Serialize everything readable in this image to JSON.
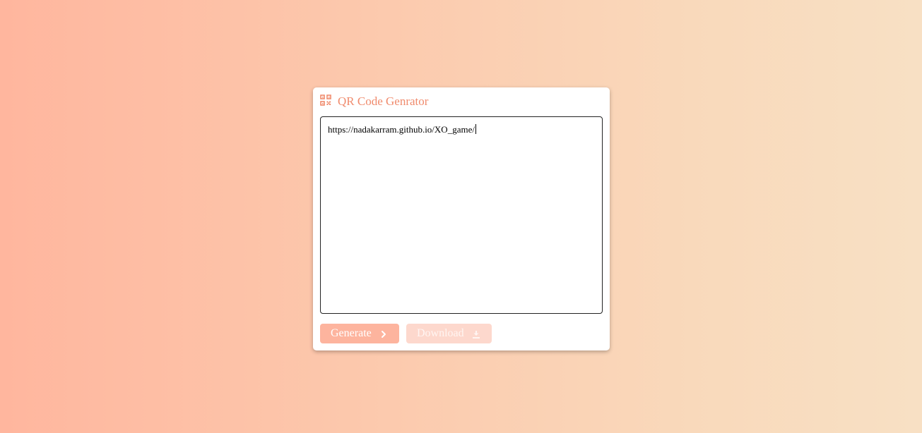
{
  "header": {
    "title": "QR Code Genrator",
    "icon": "qr-code-icon",
    "accent_color": "#f08b6d"
  },
  "input": {
    "value": "https://nadakarram.github.io/XO_game/"
  },
  "buttons": {
    "generate_label": "Generate",
    "generate_icon": "chevron-right-icon",
    "download_label": "Download",
    "download_icon": "download-icon",
    "generate_color": "#fdb49e",
    "download_color": "#fdd8cd"
  }
}
